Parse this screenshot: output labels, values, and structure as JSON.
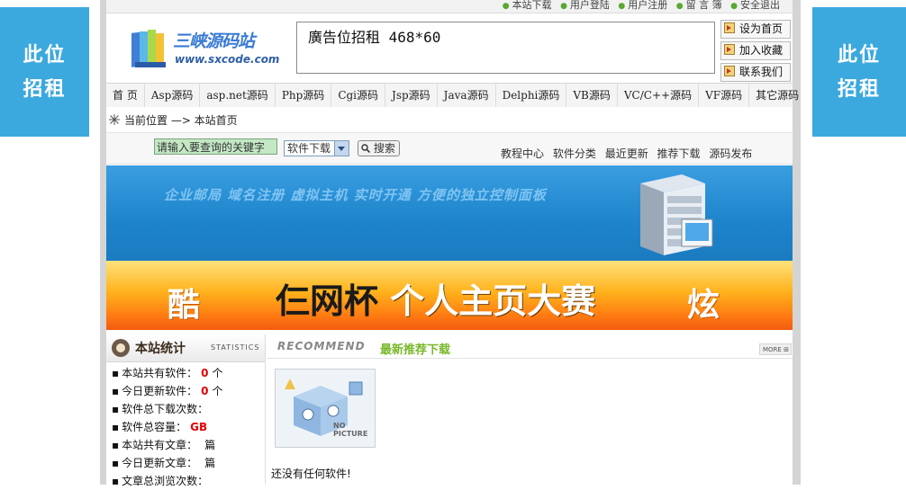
{
  "side_ads": {
    "left": {
      "line1": "此位",
      "line2": "招租"
    },
    "right": {
      "line1": "此位",
      "line2": "招租"
    }
  },
  "top_links": [
    "本站下载",
    "用户登陆",
    "用户注册",
    "留 言 簿",
    "安全退出"
  ],
  "logo": {
    "name": "三峡源码站",
    "url": "www.sxcode.com"
  },
  "banner_ad": "廣告位招租 468*60",
  "quick_links": [
    "设为首页",
    "加入收藏",
    "联系我们"
  ],
  "nav": [
    "首 页",
    "Asp源码",
    "asp.net源码",
    "Php源码",
    "Cgi源码",
    "Jsp源码",
    "Java源码",
    "Delphi源码",
    "VB源码",
    "VC/C++源码",
    "VF源码",
    "其它源码"
  ],
  "breadcrumb": "当前位置 —> 本站首页",
  "search": {
    "placeholder": "请输入要查询的关键字",
    "category": "软件下载",
    "button": "搜索"
  },
  "sub_links": [
    "教程中心",
    "软件分类",
    "最近更新",
    "推荐下载",
    "源码发布"
  ],
  "host_banner": "企业邮局 域名注册 虚拟主机 实时开通 方便的独立控制面板",
  "contest_banner": {
    "left": "酷",
    "title_dark": "仨网杯",
    "title_light": "个人主页大赛",
    "right": "炫"
  },
  "stats": {
    "title": "本站统计",
    "subtitle": "STATISTICS",
    "rows": [
      {
        "label": "本站共有软件：",
        "value": "0",
        "unit": "个"
      },
      {
        "label": "今日更新软件：",
        "value": "0",
        "unit": "个"
      },
      {
        "label": "软件总下载次数：",
        "value": "",
        "unit": ""
      },
      {
        "label": "软件总容量：",
        "value": "GB",
        "unit": ""
      },
      {
        "label": "本站共有文章：",
        "value": "",
        "unit": "篇"
      },
      {
        "label": "今日更新文章：",
        "value": "",
        "unit": "篇"
      },
      {
        "label": "文章总浏览次数：",
        "value": "",
        "unit": ""
      }
    ]
  },
  "recommend": {
    "title_en": "RECOMMEND",
    "title_cn": "最新推荐下载",
    "more": "MORE",
    "no_picture": "NO PICTURE",
    "empty": "还没有任何软件!"
  },
  "colors": {
    "side_ad_bg": "#3ba9de",
    "accent_green": "#78b82a",
    "stat_value": "#e00000"
  }
}
